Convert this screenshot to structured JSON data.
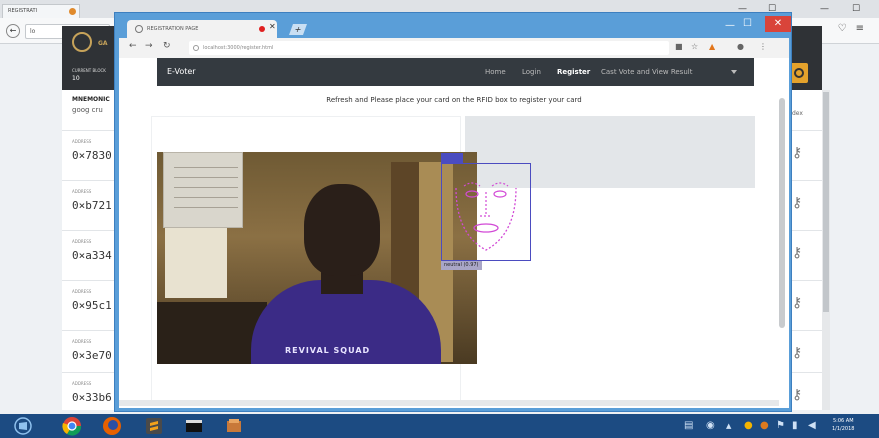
{
  "background_browser": {
    "tab_title": "REGISTRATI",
    "address": "lo",
    "header": {
      "brand": "GA",
      "current_block_label": "CURRENT BLOCK",
      "current_block_value": "10"
    },
    "mnemonic": {
      "title": "MNEMONIC",
      "words": "goog cru"
    },
    "column_hint": "dex",
    "accounts": [
      {
        "label": "ADDRESS",
        "value": "0×7830"
      },
      {
        "label": "ADDRESS",
        "value": "0×b721"
      },
      {
        "label": "ADDRESS",
        "value": "0×a334"
      },
      {
        "label": "ADDRESS",
        "value": "0×95c1"
      },
      {
        "label": "ADDRESS",
        "value": "0×3e70"
      },
      {
        "label": "ADDRESS",
        "value": "0×33b6"
      }
    ]
  },
  "foreground_browser": {
    "tab_title": "REGISTRATION PAGE",
    "address": "localhost:3000/register.html",
    "navbar": {
      "brand": "E-Voter",
      "items": [
        "Home",
        "Login",
        "Register",
        "Cast Vote and View Result"
      ],
      "active": "Register"
    },
    "instruction": "Refresh and Please place your card on the RFID box to register your card",
    "webcam": {
      "shirt_text": "REVIVAL SQUAD",
      "face_label": "neutral (0.97)"
    }
  },
  "taskbar": {
    "time": "5:06 AM",
    "date": "1/1/2018"
  },
  "colors": {
    "navbar": "#343a40",
    "window_frame": "#5a9ed8",
    "taskbar": "#1c4b82",
    "face_box": "#4b4cc0"
  }
}
